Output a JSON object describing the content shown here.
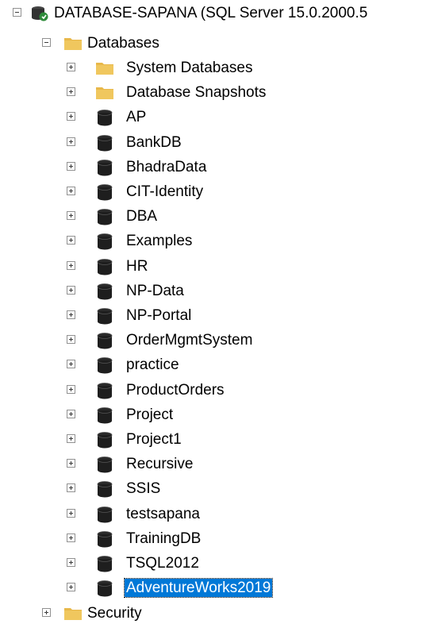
{
  "server": {
    "label": "DATABASE-SAPANA (SQL Server 15.0.2000.5",
    "icon": "server-connected-icon",
    "expanded": true
  },
  "databases_folder": {
    "label": "Databases",
    "icon": "folder-icon",
    "expanded": true
  },
  "folders": [
    {
      "label": "System Databases",
      "icon": "folder-icon"
    },
    {
      "label": "Database Snapshots",
      "icon": "folder-icon"
    }
  ],
  "databases": [
    {
      "label": "AP",
      "icon": "database-icon"
    },
    {
      "label": "BankDB",
      "icon": "database-icon"
    },
    {
      "label": "BhadraData",
      "icon": "database-icon"
    },
    {
      "label": "CIT-Identity",
      "icon": "database-icon"
    },
    {
      "label": "DBA",
      "icon": "database-icon"
    },
    {
      "label": "Examples",
      "icon": "database-icon"
    },
    {
      "label": "HR",
      "icon": "database-icon"
    },
    {
      "label": "NP-Data",
      "icon": "database-icon"
    },
    {
      "label": "NP-Portal",
      "icon": "database-icon"
    },
    {
      "label": "OrderMgmtSystem",
      "icon": "database-icon"
    },
    {
      "label": "practice",
      "icon": "database-icon"
    },
    {
      "label": "ProductOrders",
      "icon": "database-icon"
    },
    {
      "label": "Project",
      "icon": "database-icon"
    },
    {
      "label": "Project1",
      "icon": "database-icon"
    },
    {
      "label": "Recursive",
      "icon": "database-icon"
    },
    {
      "label": "SSIS",
      "icon": "database-icon"
    },
    {
      "label": "testsapana",
      "icon": "database-icon"
    },
    {
      "label": "TrainingDB",
      "icon": "database-icon"
    },
    {
      "label": "TSQL2012",
      "icon": "database-icon"
    },
    {
      "label": "AdventureWorks2019",
      "icon": "database-icon",
      "selected": true
    }
  ],
  "security_folder": {
    "label": "Security",
    "icon": "folder-icon",
    "expanded": false
  },
  "colors": {
    "selection": "#0078d7",
    "folder": "#e8b84a",
    "database": "#1e1e1e",
    "server_badge": "#2e8b3a"
  }
}
